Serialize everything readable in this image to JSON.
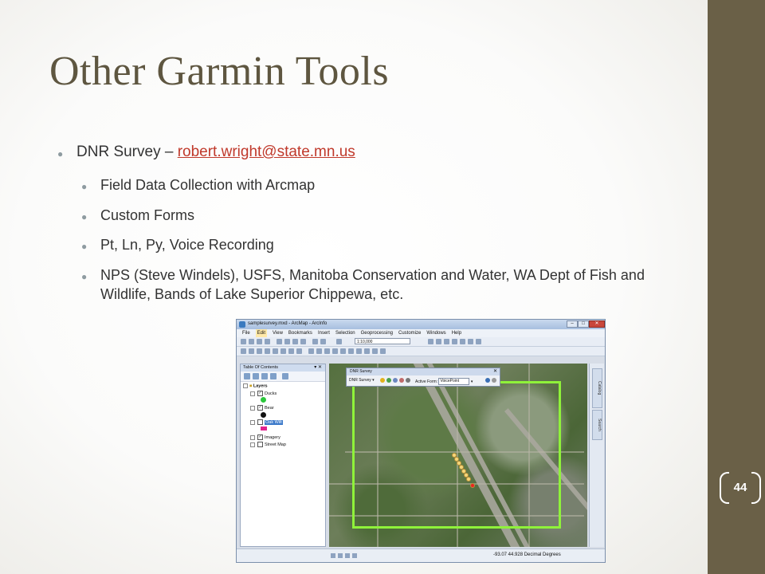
{
  "slide": {
    "title": "Other Garmin Tools",
    "page_number": "44",
    "bullet1_prefix": "DNR Survey – ",
    "bullet1_link": "robert.wright@state.mn.us",
    "sub_bullets": [
      "Field Data Collection with Arcmap",
      "Custom Forms",
      "Pt, Ln, Py, Voice Recording",
      "NPS (Steve Windels), USFS, Manitoba Conservation and Water, WA Dept of Fish and Wildlife, Bands of Lake Superior Chippewa, etc."
    ],
    "colors": {
      "sidebar": "#6a6047",
      "title": "#5e5640",
      "link": "#c0392b"
    }
  },
  "arcmap": {
    "window_title": "samplesurvey.mxd - ArcMap - ArcInfo",
    "menu": [
      "File",
      "Edit",
      "View",
      "Bookmarks",
      "Insert",
      "Selection",
      "Geoprocessing",
      "Customize",
      "Windows",
      "Help"
    ],
    "scale": "1:10,000",
    "toc_title": "Table Of Contents",
    "layers_root": "Layers",
    "layers": [
      "Ducks",
      "Bear",
      "Oak Wilt",
      "Imagery",
      "Street Map"
    ],
    "dnr_toolbar_title": "DNR Survey",
    "dnr_menu": "DNR Survey",
    "active_form_label": "Active Form:",
    "active_form_value": "VoicePoint",
    "right_tabs": [
      "Catalog",
      "Search"
    ],
    "coords": "-93.07  44.928 Decimal Degrees"
  }
}
